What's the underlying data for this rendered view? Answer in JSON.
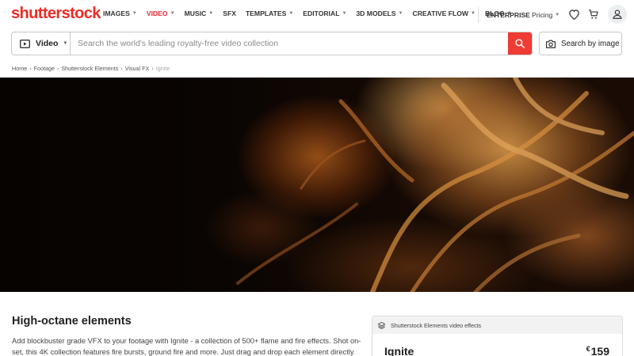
{
  "header": {
    "logo": "shutterstock",
    "nav": [
      {
        "label": "IMAGES",
        "has_dropdown": true,
        "active": false
      },
      {
        "label": "VIDEO",
        "has_dropdown": true,
        "active": true
      },
      {
        "label": "MUSIC",
        "has_dropdown": true,
        "active": false
      },
      {
        "label": "SFX",
        "has_dropdown": false,
        "active": false
      },
      {
        "label": "TEMPLATES",
        "has_dropdown": true,
        "active": false
      },
      {
        "label": "EDITORIAL",
        "has_dropdown": true,
        "active": false
      },
      {
        "label": "3D MODELS",
        "has_dropdown": true,
        "active": false
      },
      {
        "label": "CREATIVE FLOW",
        "has_dropdown": true,
        "active": false
      },
      {
        "label": "BLOG",
        "has_dropdown": true,
        "active": false
      }
    ],
    "enterprise_label": "ENTERPRISE",
    "pricing_label": "Pricing",
    "icons": [
      "heart-icon",
      "cart-icon",
      "user-icon"
    ],
    "accent_color": "#ee2b24"
  },
  "search": {
    "media_type": "Video",
    "placeholder": "Search the world's leading royalty-free video collection",
    "value": "",
    "image_search_label": "Search by image"
  },
  "breadcrumb": [
    "Home",
    "Footage",
    "Shutterstock Elements",
    "Visual FX",
    "Ignite"
  ],
  "hero": {
    "description": "Close-up of fire flames on a dark background"
  },
  "content": {
    "heading": "High-octane elements",
    "description": "Add blockbuster grade VFX to your footage with Ignite - a collection of 500+ flame and fire effects. Shot on-set, this 4K collection features fire bursts, ground fire and more. Just drag and drop each element directly"
  },
  "pack": {
    "header": "Shutterstock Elements video effects",
    "name": "Ignite",
    "currency": "€",
    "price": "159"
  }
}
